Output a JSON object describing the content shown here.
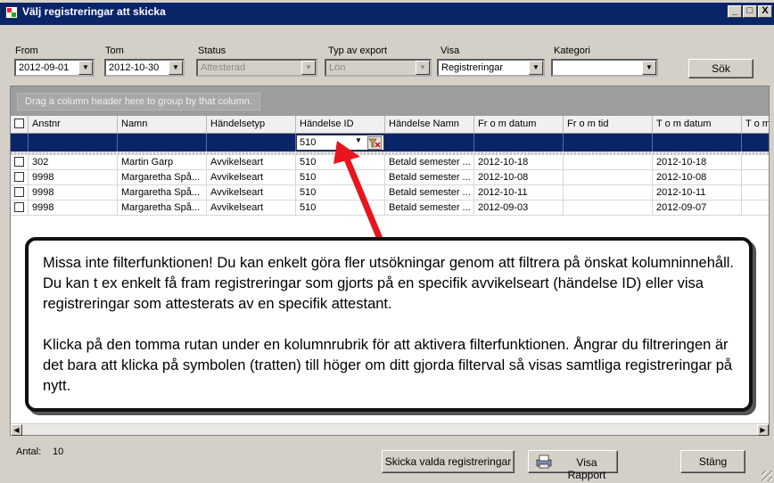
{
  "window": {
    "title": "Välj registreringar att skicka",
    "controls": [
      "_",
      "□",
      "X"
    ]
  },
  "filters": {
    "from": {
      "label": "From",
      "value": "2012-09-01"
    },
    "tom": {
      "label": "Tom",
      "value": "2012-10-30"
    },
    "status": {
      "label": "Status",
      "value": "Attesterad"
    },
    "typ": {
      "label": "Typ av export",
      "value": "Lön"
    },
    "visa": {
      "label": "Visa",
      "value": "Registreringar"
    },
    "kategori": {
      "label": "Kategori",
      "value": ""
    },
    "search_label": "Sök"
  },
  "grid": {
    "group_hint": "Drag a column header here to group by that column.",
    "columns": [
      "Anstnr",
      "Namn",
      "Händelsetyp",
      "Händelse ID",
      "Händelse Namn",
      "Fr o m datum",
      "Fr o m tid",
      "T o m datum",
      "T o m"
    ],
    "filter_value": "510",
    "rows": [
      [
        "302",
        "Martin Garp",
        "Avvikelseart",
        "510",
        "Betald semester ...",
        "2012-10-18",
        "",
        "2012-10-18"
      ],
      [
        "9998",
        "Margaretha Spå...",
        "Avvikelseart",
        "510",
        "Betald semester ...",
        "2012-10-08",
        "",
        "2012-10-08"
      ],
      [
        "9998",
        "Margaretha Spå...",
        "Avvikelseart",
        "510",
        "Betald semester ...",
        "2012-10-11",
        "",
        "2012-10-11"
      ],
      [
        "9998",
        "Margaretha Spå...",
        "Avvikelseart",
        "510",
        "Betald semester ...",
        "2012-09-03",
        "",
        "2012-09-07"
      ]
    ]
  },
  "callout": {
    "p1": "Missa inte filterfunktionen! Du kan enkelt göra fler utsökningar genom att filtrera på önskat kolumninnehåll.  Du kan t ex enkelt få fram registreringar som gjorts på en specifik avvikelseart (händelse ID) eller visa registreringar som attesterats av en specifik attestant.",
    "p2": "Klicka på den tomma rutan under en kolumnrubrik för att aktivera filterfunktionen. Ångrar du filtreringen är det bara att klicka på symbolen (tratten) till höger om ditt gjorda filterval så visas samtliga registreringar på nytt."
  },
  "footer": {
    "count_label": "Antal:",
    "count_value": "10",
    "send_button": "Skicka valda registreringar",
    "report_button": "Visa Rapport",
    "close_button": "Stäng"
  },
  "colors": {
    "titlebar": "#0a246a",
    "filter_row": "#0a246a",
    "arrow": "#e8141e",
    "window_bg": "#d4d0c8"
  }
}
